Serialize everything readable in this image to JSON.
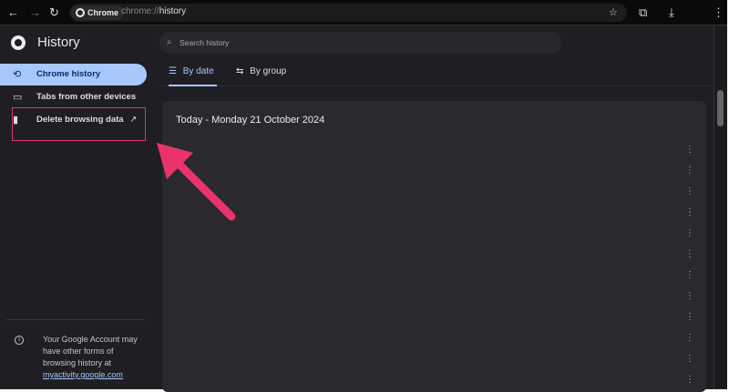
{
  "toolbar": {
    "chip": "Chrome",
    "url_scheme": "chrome://",
    "url_path": "history"
  },
  "sidebar": {
    "title": "History",
    "items": [
      {
        "label": "Chrome history",
        "icon": "history-icon"
      },
      {
        "label": "Tabs from other devices",
        "icon": "devices-icon"
      },
      {
        "label": "Delete browsing data",
        "icon": "trash-icon"
      }
    ],
    "note": "Your Google Account may have other forms of browsing history at",
    "note_link": "myactivity.google.com"
  },
  "main": {
    "search_placeholder": "Search history",
    "tabs": [
      {
        "label": "By date"
      },
      {
        "label": "By group"
      }
    ],
    "day_heading": "Today - Monday 21 October 2024"
  },
  "colors": {
    "accent": "#a8c7fa",
    "annotation": "#e8336b"
  }
}
